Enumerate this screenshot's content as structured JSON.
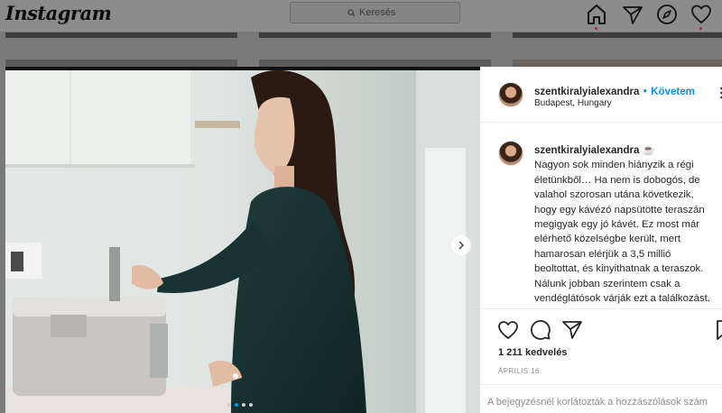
{
  "nav": {
    "logo": "Instagram",
    "search_placeholder": "Keresés",
    "icons": [
      "home-icon",
      "direct-icon",
      "explore-icon",
      "activity-icon"
    ]
  },
  "post": {
    "username": "szentkiralyialexandra",
    "follow_separator": "•",
    "follow_label": "Követem",
    "location": "Budapest, Hungary",
    "caption_username": "szentkiralyialexandra",
    "caption_emoji": "☕",
    "caption_lines": [
      "Nagyon sok minden hiányzik a régi",
      "életünkből… Ha nem is dobogós, de",
      "valahol szorosan utána következik,",
      "hogy egy kávézó napsütötte teraszán",
      "megigyak egy jó kávét. Ez most már",
      "elérhető közelségbe került, mert",
      "hamarosan elérjük a 3,5 millió",
      "beoltottat, és kinyithatnak a teraszok.",
      "Nálunk jobban szerintem csak a",
      "vendéglátósok várják ezt a találkozást."
    ],
    "likes": "1 211 kedvelés",
    "date": "ÁPRILIS 16.",
    "comments_disabled": "A bejegyzésnél korlátozták a hozzászólások szám",
    "carousel_dots": 4,
    "carousel_active": 1
  },
  "colors": {
    "accent": "#0095f6",
    "nav_dot": "#b5202e",
    "overlay": "#7a7a7a"
  }
}
